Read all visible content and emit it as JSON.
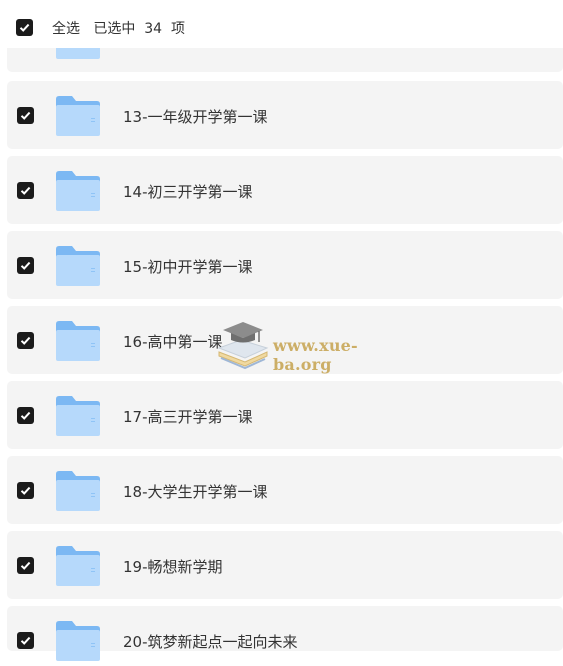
{
  "header": {
    "select_all": "全选",
    "selected_prefix": "已选中",
    "selected_count": "34",
    "selected_suffix": "项"
  },
  "items": [
    {
      "label": "",
      "icon": "folder-icon",
      "checked": true
    },
    {
      "label": "13-一年级开学第一课",
      "icon": "folder-icon",
      "checked": true
    },
    {
      "label": "14-初三开学第一课",
      "icon": "folder-icon",
      "checked": true
    },
    {
      "label": "15-初中开学第一课",
      "icon": "folder-icon",
      "checked": true
    },
    {
      "label": "16-高中第一课",
      "icon": "folder-icon",
      "checked": true
    },
    {
      "label": "17-高三开学第一课",
      "icon": "folder-icon",
      "checked": true
    },
    {
      "label": "18-大学生开学第一课",
      "icon": "folder-icon",
      "checked": true
    },
    {
      "label": "19-畅想新学期",
      "icon": "folder-icon",
      "checked": true
    },
    {
      "label": "20-筑梦新起点一起向未来",
      "icon": "folder-icon",
      "checked": true
    }
  ],
  "watermark": {
    "text": "www.xue-ba.org",
    "icon": "graduation-cap-books-icon"
  },
  "colors": {
    "row_bg": "#f4f4f4",
    "checkbox": "#1b1b1b",
    "folder_light": "#b6d9fb",
    "folder_dark": "#7cb8f3",
    "watermark": "#c6a24e"
  }
}
